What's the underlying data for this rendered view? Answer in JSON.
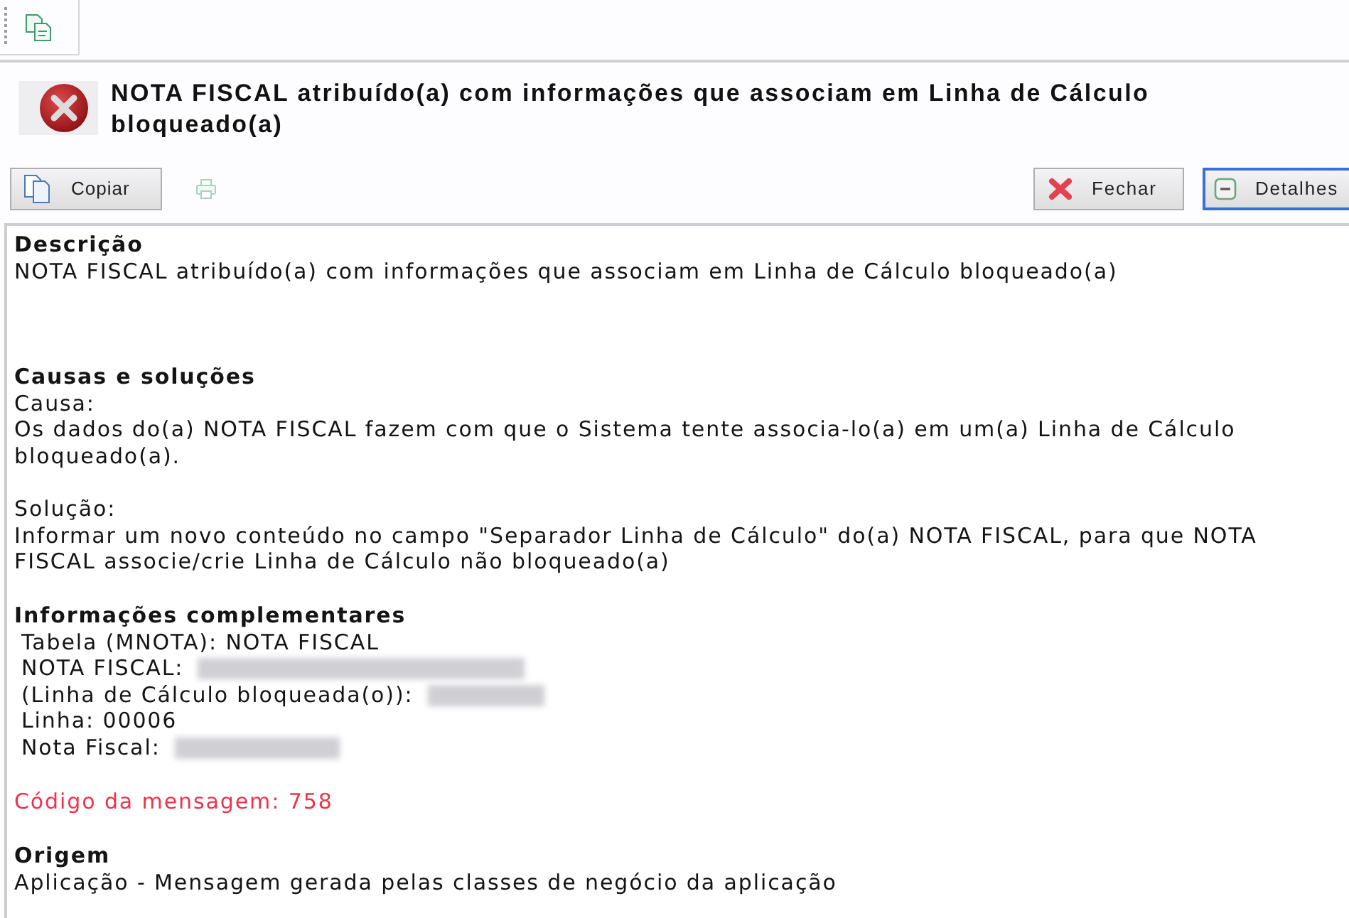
{
  "message": {
    "title": "NOTA FISCAL atribuído(a) com informações que associam em Linha de Cálculo bloqueado(a)"
  },
  "actions_left": [
    {
      "kind": "copy",
      "label": "Copiar",
      "disabled": false
    },
    {
      "kind": "print",
      "disabled": true
    }
  ],
  "actions_right": [
    {
      "kind": "close",
      "label": "Fechar",
      "focused": false
    },
    {
      "kind": "details",
      "label": "Detalhes",
      "focused": true
    }
  ],
  "details": [
    {
      "kind": "section",
      "heading": "Descrição",
      "paragraphs": [
        {
          "text": "NOTA FISCAL atribuído(a) com informações que associam em Linha de Cálculo bloqueado(a)"
        }
      ]
    },
    {
      "kind": "section",
      "heading": "Causas e soluções",
      "paragraphs": [
        {
          "label": "Causa:",
          "text": "Os dados do(a) NOTA FISCAL fazem com que o Sistema tente associa-lo(a) em um(a) Linha de Cálculo bloqueado(a)."
        },
        {
          "label": "Solução:",
          "text": "Informar um novo conteúdo no campo \"Separador Linha de Cálculo\" do(a) NOTA FISCAL, para que NOTA FISCAL associe/crie Linha de Cálculo não bloqueado(a)"
        }
      ]
    },
    {
      "kind": "info",
      "heading": "Informações complementares",
      "lines": [
        {
          "text": "Tabela (MNOTA): NOTA FISCAL",
          "redacted": false
        },
        {
          "text": "NOTA FISCAL:",
          "redacted": true
        },
        {
          "text": "(Linha de Cálculo bloqueada(o)):",
          "redacted": true
        },
        {
          "text": "Linha: 00006",
          "redacted": false
        },
        {
          "text": "Nota Fiscal:",
          "redacted": true
        }
      ]
    },
    {
      "kind": "code",
      "text": "Código da mensagem: 758"
    },
    {
      "kind": "section",
      "heading": "Origem",
      "paragraphs": [
        {
          "text": "Aplicação - Mensagem gerada pelas classes de negócio da aplicação"
        }
      ]
    }
  ]
}
